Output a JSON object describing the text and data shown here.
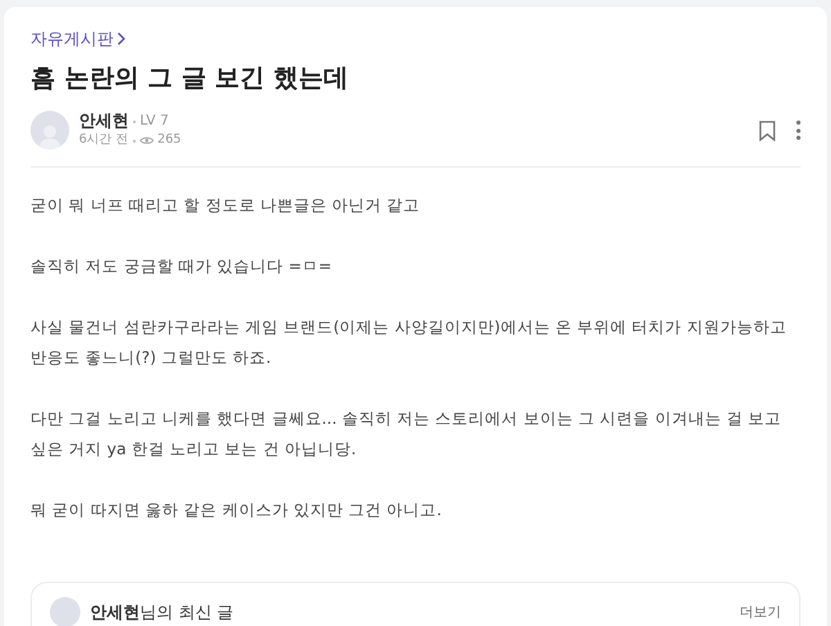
{
  "board": {
    "label": "자유게시판"
  },
  "post": {
    "title": "흠 논란의 그 글 보긴 했는데",
    "author": {
      "name": "안세현",
      "level": "LV 7",
      "time": "6시간 전",
      "views": "265"
    },
    "paragraphs": [
      "굳이 뭐 너프 때리고 할 정도로 나쁜글은 아닌거 같고",
      "솔직히 저도 궁금할 때가 있습니다 =ㅁ=",
      "사실 물건너 섬란카구라라는 게임 브랜드(이제는 사양길이지만)에서는 온 부위에 터치가 지원가능하고 반응도 좋느니(?) 그럴만도 하죠.",
      "다만 그걸 노리고 니케를 했다면 글쎄요... 솔직히 저는 스토리에서 보이는 그 시련을 이겨내는 걸 보고싶은 거지 ya 한걸 노리고 보는 건 아닙니당.",
      "뭐 굳이 따지면 욿하 같은 케이스가 있지만 그건 아니고."
    ]
  },
  "latest_posts": {
    "heading": "**안세현**님의 최신 글",
    "more": "더보기"
  }
}
